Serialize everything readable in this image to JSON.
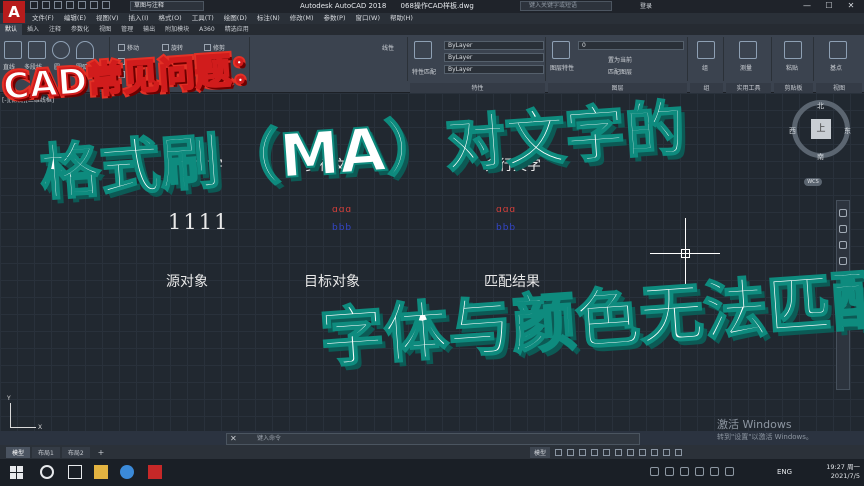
{
  "app": {
    "logo_letter": "A",
    "workspace": "草图与注释",
    "title_app": "Autodesk AutoCAD 2018",
    "title_file": "068操作CAD样板.dwg",
    "search_placeholder": "键入关键字或短语",
    "login": "登录",
    "win_min": "—",
    "win_max": "☐",
    "win_close": "✕"
  },
  "menu": [
    "文件(F)",
    "编辑(E)",
    "视图(V)",
    "插入(I)",
    "格式(O)",
    "工具(T)",
    "绘图(D)",
    "标注(N)",
    "修改(M)",
    "参数(P)",
    "窗口(W)",
    "帮助(H)"
  ],
  "ribbon_tabs": [
    "默认",
    "插入",
    "注释",
    "参数化",
    "视图",
    "管理",
    "输出",
    "附加模块",
    "A360",
    "精选应用"
  ],
  "ribbon": {
    "draw_tools": [
      "直线",
      "多段线",
      "圆",
      "圆弧"
    ],
    "modify_tools": [
      "移动",
      "旋转",
      "修剪",
      "复制",
      "镜像",
      "拉伸"
    ],
    "layer_combo": "ByLayer",
    "linetype_combo": "ByLayer",
    "lineweight_combo": "ByLayer",
    "layer_name": "0",
    "set_current": "置为当前",
    "match_layer": "匹配图层",
    "match_props": "特性匹配",
    "linewidth": "线性",
    "panel_properties": "特性",
    "panel_group": "组",
    "panel_utilities": "实用工具",
    "panel_clipboard": "剪贴板",
    "panel_view": "视图",
    "measure": "测量",
    "paste": "粘贴",
    "base": "基点",
    "group": "组",
    "layer_props": "图层特性",
    "layer": "图层"
  },
  "canvas": {
    "viewport_label": "[-][俯视][二维线框]",
    "label_single": "单行文字",
    "label_multi1": "多行文字",
    "label_multi2": "多行文字",
    "big_text": "1111",
    "sample_red_1": "ɑɑɑ",
    "sample_red_2": "ɑɑɑ",
    "sample_blue_1": "bbb",
    "sample_blue_2": "bbb",
    "label_source": "源对象",
    "label_target": "目标对象",
    "label_result": "匹配结果",
    "ucs_y": "Y",
    "ucs_x": "X"
  },
  "viewcube": {
    "north": "北",
    "south": "南",
    "east": "东",
    "west": "西",
    "top_face": "上",
    "wcs": "WCS"
  },
  "overlay": {
    "top": "CAD常见问题：",
    "middle": "格式刷（MA）对文字的",
    "bottom": "字体与颜色无法匹配"
  },
  "command": {
    "close": "✕",
    "prompt": "键入命令"
  },
  "watermark": {
    "line1": "激活 Windows",
    "line2": "转到\"设置\"以激活 Windows。"
  },
  "layout_tabs": [
    "模型",
    "布局1",
    "布局2",
    "+"
  ],
  "status": {
    "model": "模型"
  },
  "taskbar": {
    "lang": "ENG",
    "time": "19:27 周一",
    "date": "2021/7/5"
  },
  "colors": {
    "overlay_red": "#e33126",
    "overlay_teal": "#0e8b7e",
    "canvas_bg": "#212830"
  }
}
